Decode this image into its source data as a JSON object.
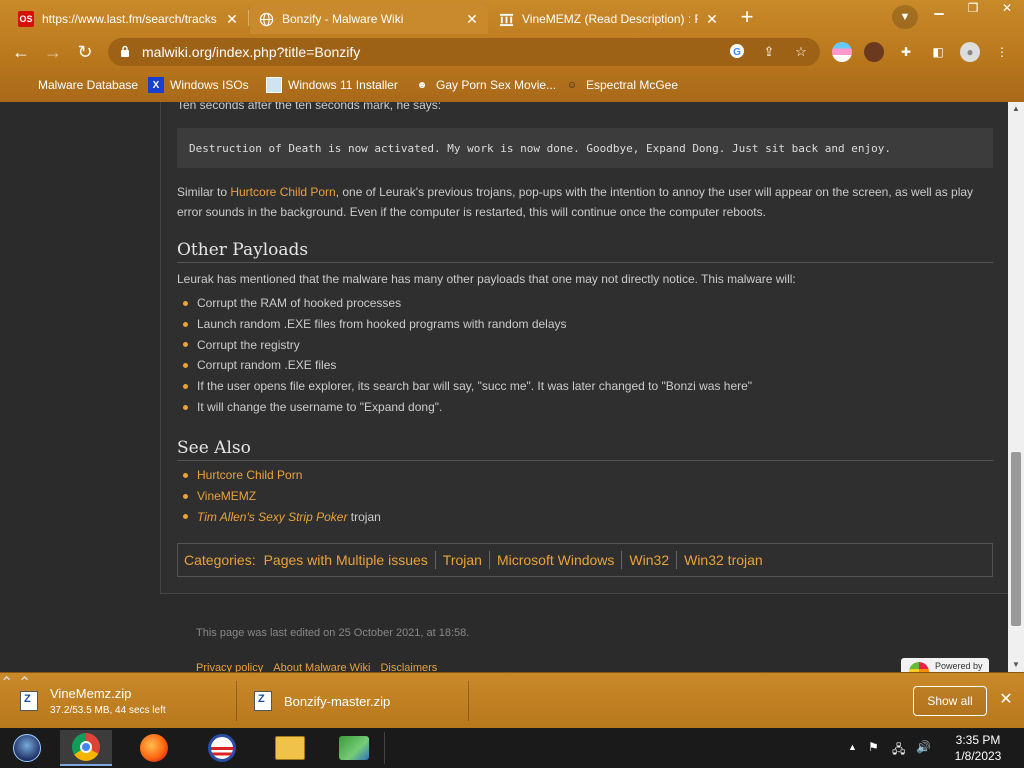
{
  "tabs": [
    {
      "label": "https://www.last.fm/search/tracks",
      "icon": "lastfm-icon",
      "favicon_text": "OS",
      "active": false
    },
    {
      "label": "Bonzify - Malware Wiki",
      "icon": "globe-icon",
      "active": true
    },
    {
      "label": "VineMEMZ (Read Description) : F",
      "icon": "archive-icon",
      "active": false
    }
  ],
  "address_bar": {
    "url": "malwiki.org/index.php?title=Bonzify"
  },
  "bookmarks": [
    {
      "label": "Malware Database",
      "icon": "folder-icon"
    },
    {
      "label": "Windows ISOs",
      "icon": "x-logo-icon",
      "icon_text": "X"
    },
    {
      "label": "Windows 11 Installer",
      "icon": "image-icon"
    },
    {
      "label": "Gay Porn Sex Movie...",
      "icon": "figure-icon"
    },
    {
      "label": "Espectral McGee",
      "icon": "avatar-icon"
    }
  ],
  "article": {
    "cut_text": "Ten seconds after the ten seconds mark, he says:",
    "code_quote": "Destruction of Death is now activated. My work is now done. Goodbye, Expand Dong. Just sit back and enjoy.",
    "para": {
      "before": "Similar to ",
      "link": "Hurtcore Child Porn",
      "after": ", one of Leurak's previous trojans, pop-ups with the intention to annoy the user will appear on the screen, as well as play error sounds in the background. Even if the computer is restarted, this will continue once the computer reboots."
    },
    "other_payloads": {
      "heading": "Other Payloads",
      "intro": "Leurak has mentioned that the malware has many other payloads that one may not directly notice. This malware will:",
      "items": [
        "Corrupt the RAM of hooked processes",
        "Launch random .EXE files from hooked programs with random delays",
        "Corrupt the registry",
        "Corrupt random .EXE files",
        "If the user opens file explorer, its search bar will say, \"succ me\". It was later changed to \"Bonzi was here\"",
        "It will change the username to \"Expand dong\"."
      ]
    },
    "see_also": {
      "heading": "See Also",
      "items": [
        {
          "link": "Hurtcore Child Porn",
          "suffix": ""
        },
        {
          "link": "VineMEMZ",
          "suffix": ""
        },
        {
          "link": "Tim Allen's Sexy Strip Poker",
          "suffix": " trojan"
        }
      ]
    },
    "categories": {
      "label": "Categories",
      "items": [
        "Pages with Multiple issues",
        "Trojan",
        "Microsoft Windows",
        "Win32",
        "Win32 trojan"
      ]
    },
    "footer": {
      "last_edited": "This page was last edited on 25 October 2021, at 18:58.",
      "links": [
        "Privacy policy",
        "About Malware Wiki",
        "Disclaimers"
      ],
      "powered_by": "Powered by"
    }
  },
  "downloads": [
    {
      "name": "VineMemz.zip",
      "status": "37.2/53.5 MB, 44 secs left"
    },
    {
      "name": "Bonzify-master.zip",
      "status": ""
    }
  ],
  "download_bar": {
    "show_all": "Show all"
  },
  "taskbar": {
    "apps": [
      "start-orb",
      "chrome",
      "firefox",
      "obama-app",
      "file-explorer",
      "network-app"
    ],
    "clock_time": "3:35 PM",
    "clock_date": "1/8/2023"
  },
  "colors": {
    "accent": "#e9a23b",
    "chrome": "#c08126",
    "page_bg": "#2f2f2f"
  }
}
